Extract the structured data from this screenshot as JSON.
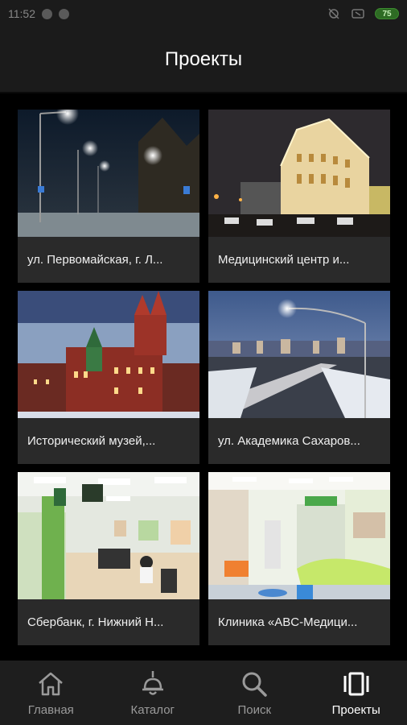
{
  "status": {
    "time": "11:52",
    "battery": "75"
  },
  "header": {
    "title": "Проекты"
  },
  "projects": [
    {
      "caption": "ул. Первомайская, г. Л..."
    },
    {
      "caption": "Медицинский центр и..."
    },
    {
      "caption": "Исторический музей,..."
    },
    {
      "caption": "ул. Академика Сахаров..."
    },
    {
      "caption": "Сбербанк, г. Нижний Н..."
    },
    {
      "caption": "Клиника «ABC-Медици..."
    }
  ],
  "nav": {
    "home": "Главная",
    "catalog": "Каталог",
    "search": "Поиск",
    "projects": "Проекты"
  }
}
